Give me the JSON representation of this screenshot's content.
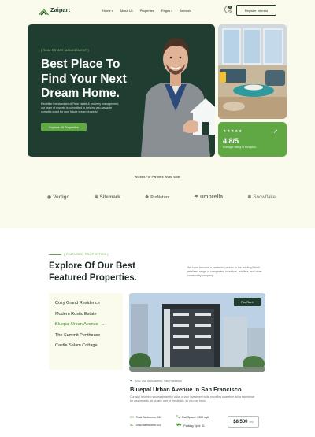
{
  "brand": {
    "name": "Zaipart"
  },
  "nav": {
    "items": [
      {
        "label": "Home",
        "dropdown": true
      },
      {
        "label": "About Us",
        "dropdown": false
      },
      {
        "label": "Properties",
        "dropdown": false
      },
      {
        "label": "Pages",
        "dropdown": true
      },
      {
        "label": "Services",
        "dropdown": false
      }
    ],
    "cart_count": "0",
    "register_label": "Register Interest"
  },
  "hero": {
    "tag": "[ REAL ESTATE MANAGEMENT ]",
    "title_line1": "Best Place To",
    "title_line2": "Find Your Next",
    "title_line3": "Dream Home.",
    "description": "Redefine the standard of Real estate & property management, our team of experts is committed to helping you navigate complex world for your future dream property.",
    "cta_label": "Explore All Properties"
  },
  "rating": {
    "stars": "★★★★★",
    "value": "4.8/5",
    "label": "Average rating in trustpilot."
  },
  "partners": {
    "title": "Worked For Partners World Wide",
    "items": [
      {
        "name": "Vertigo",
        "icon": "vertigo-icon"
      },
      {
        "name": "Sitemark",
        "icon": "sitemark-icon"
      },
      {
        "name": "ProNature",
        "icon": "pronature-icon"
      },
      {
        "name": "umbrella",
        "icon": "umbrella-icon"
      },
      {
        "name": "Snowflake",
        "icon": "snowflake-icon"
      }
    ]
  },
  "featured": {
    "tag": "[ FEATURED PROPERTIES ]",
    "title_line1": "Explore Of Our Best",
    "title_line2": "Featured Properties.",
    "description": "We have become a preferred partner to the leading Retail retailers, range of companies, investors, retailers, and other community company.",
    "list": [
      "Cozy Grand Residence",
      "Modern Rustic Estate",
      "Bluepal Urban Avenue",
      "The Summit Penthouse",
      "Castle Salam Cottage"
    ],
    "active_index": 2
  },
  "property": {
    "badge": "For Rent",
    "address": "3201 2nd St Buckfield, San Francisco",
    "title": "Bluepal Urban Avenue In San Francisco",
    "description": "Our goal is to help you maximize the value of your investment while providing a carefree living experience for your tenants, let us take care of the details, so you can focus.",
    "features": {
      "bedrooms": "Total Bedrooms: 06",
      "flat_space": "Flat Space: 3300 sqft",
      "bathrooms": "Total Bathrooms: 03",
      "parking": "Parking Spot: 01"
    },
    "price": "$8,500",
    "price_unit": "/mo"
  }
}
